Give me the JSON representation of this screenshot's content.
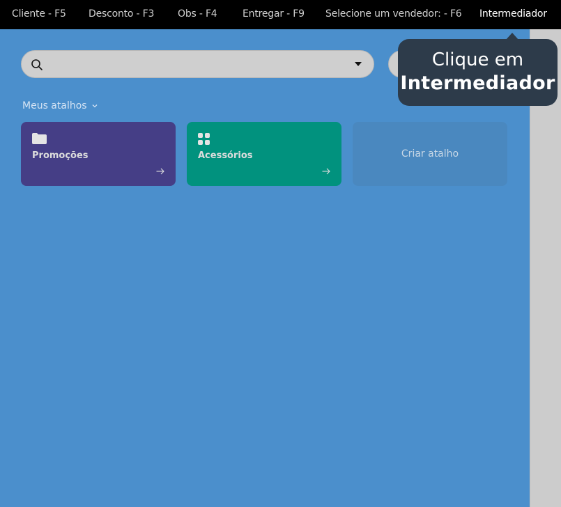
{
  "topbar": {
    "items": [
      {
        "label": "Cliente - F5"
      },
      {
        "label": "Desconto - F3"
      },
      {
        "label": "Obs - F4"
      },
      {
        "label": "Entregar - F9"
      },
      {
        "label": "Selecione um vendedor: - F6"
      },
      {
        "label": "Intermediador"
      }
    ]
  },
  "search": {
    "value": "",
    "placeholder": "",
    "icon": "search-icon"
  },
  "shortcuts": {
    "header": "Meus atalhos",
    "cards": [
      {
        "label": "Promoções",
        "icon": "folder-icon",
        "color": "#453e86"
      },
      {
        "label": "Acessórios",
        "icon": "grid-icon",
        "color": "#01927e"
      }
    ],
    "create_label": "Criar atalho"
  },
  "tooltip": {
    "line1": "Clique em",
    "line2": "Intermediador"
  },
  "colors": {
    "background": "#4b8fcc",
    "topbar": "#000000",
    "tooltip": "#2d3b4a"
  }
}
